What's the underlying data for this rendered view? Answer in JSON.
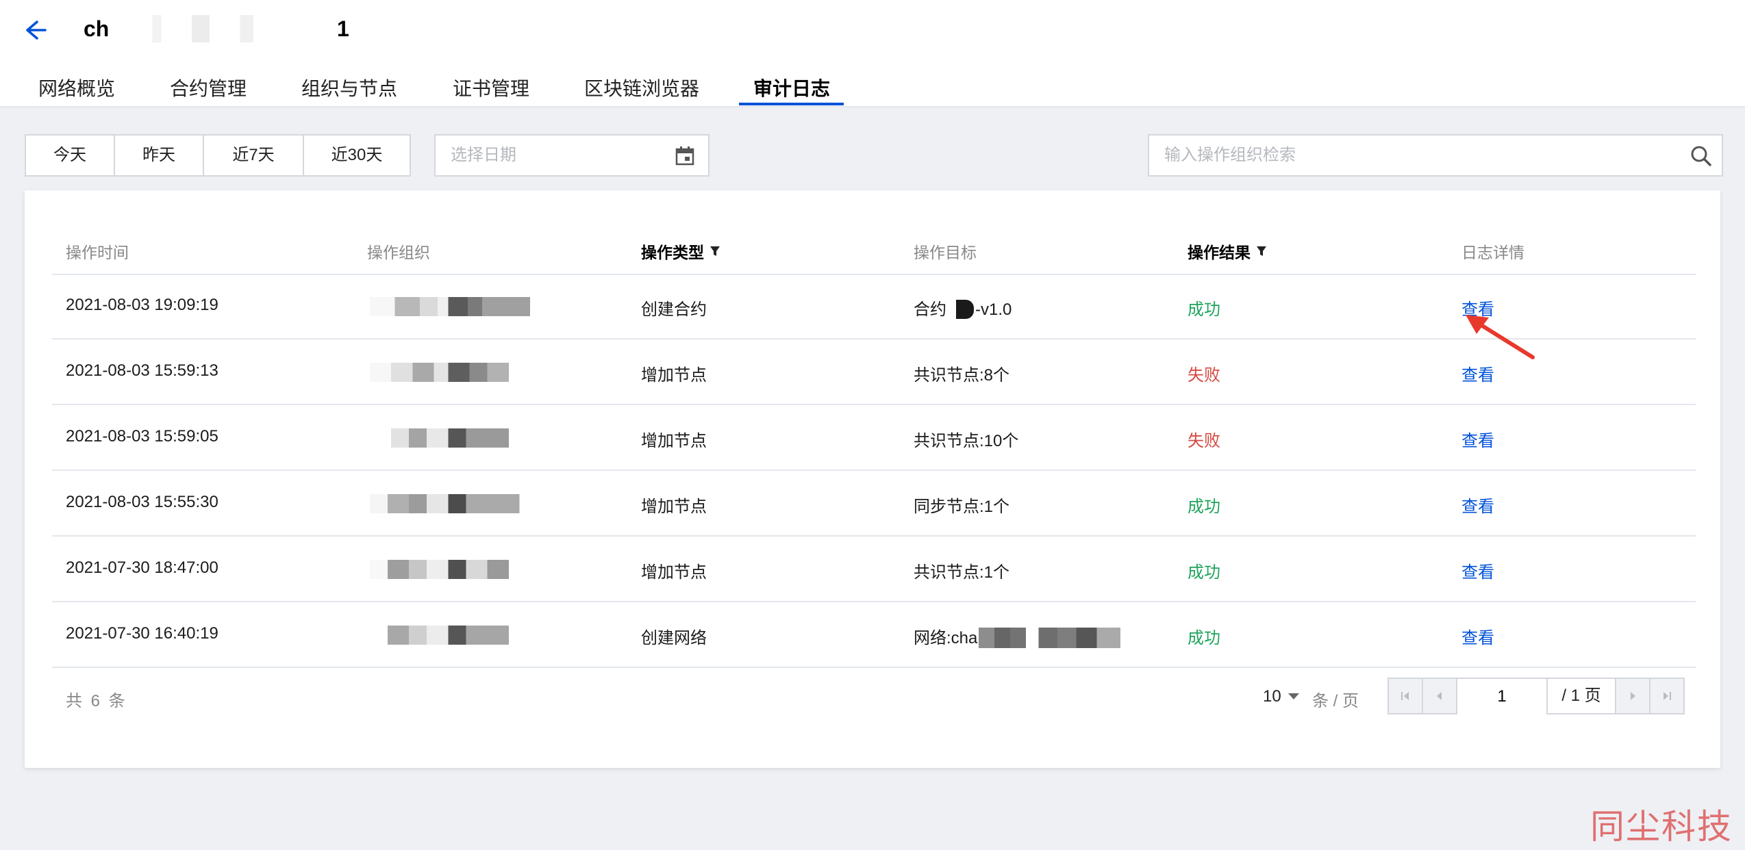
{
  "header": {
    "title_prefix": "ch",
    "title_suffix": "1",
    "tabs": [
      "网络概览",
      "合约管理",
      "组织与节点",
      "证书管理",
      "区块链浏览器",
      "审计日志"
    ],
    "active_tab": "审计日志"
  },
  "filters": {
    "ranges": [
      "今天",
      "昨天",
      "近7天",
      "近30天"
    ],
    "date_placeholder": "选择日期",
    "search_placeholder": "输入操作组织检索"
  },
  "table": {
    "columns": [
      "操作时间",
      "操作组织",
      "操作类型",
      "操作目标",
      "操作结果",
      "日志详情"
    ],
    "rows": [
      {
        "time": "2021-08-03 19:09:19",
        "type": "创建合约",
        "target": "合约",
        "target_suffix": "-v1.0",
        "result": "成功",
        "status": "ok",
        "action": "查看"
      },
      {
        "time": "2021-08-03 15:59:13",
        "type": "增加节点",
        "target": "共识节点:8个",
        "target_suffix": "",
        "result": "失败",
        "status": "fail",
        "action": "查看"
      },
      {
        "time": "2021-08-03 15:59:05",
        "type": "增加节点",
        "target": "共识节点:10个",
        "target_suffix": "",
        "result": "失败",
        "status": "fail",
        "action": "查看"
      },
      {
        "time": "2021-08-03 15:55:30",
        "type": "增加节点",
        "target": "同步节点:1个",
        "target_suffix": "",
        "result": "成功",
        "status": "ok",
        "action": "查看"
      },
      {
        "time": "2021-07-30 18:47:00",
        "type": "增加节点",
        "target": "共识节点:1个",
        "target_suffix": "",
        "result": "成功",
        "status": "ok",
        "action": "查看"
      },
      {
        "time": "2021-07-30 16:40:19",
        "type": "创建网络",
        "target": "网络:cha",
        "target_suffix": "",
        "result": "成功",
        "status": "ok",
        "action": "查看"
      }
    ]
  },
  "footer": {
    "total": "共 6 条",
    "page_size": "10",
    "per_page_label": "条 / 页",
    "current_page": "1",
    "total_pages": "/ 1 页"
  },
  "watermark": "同尘科技",
  "colors": {
    "primary": "#0052d9",
    "success": "#1fa45c",
    "danger": "#d54941",
    "annotation": "#e8392d"
  }
}
